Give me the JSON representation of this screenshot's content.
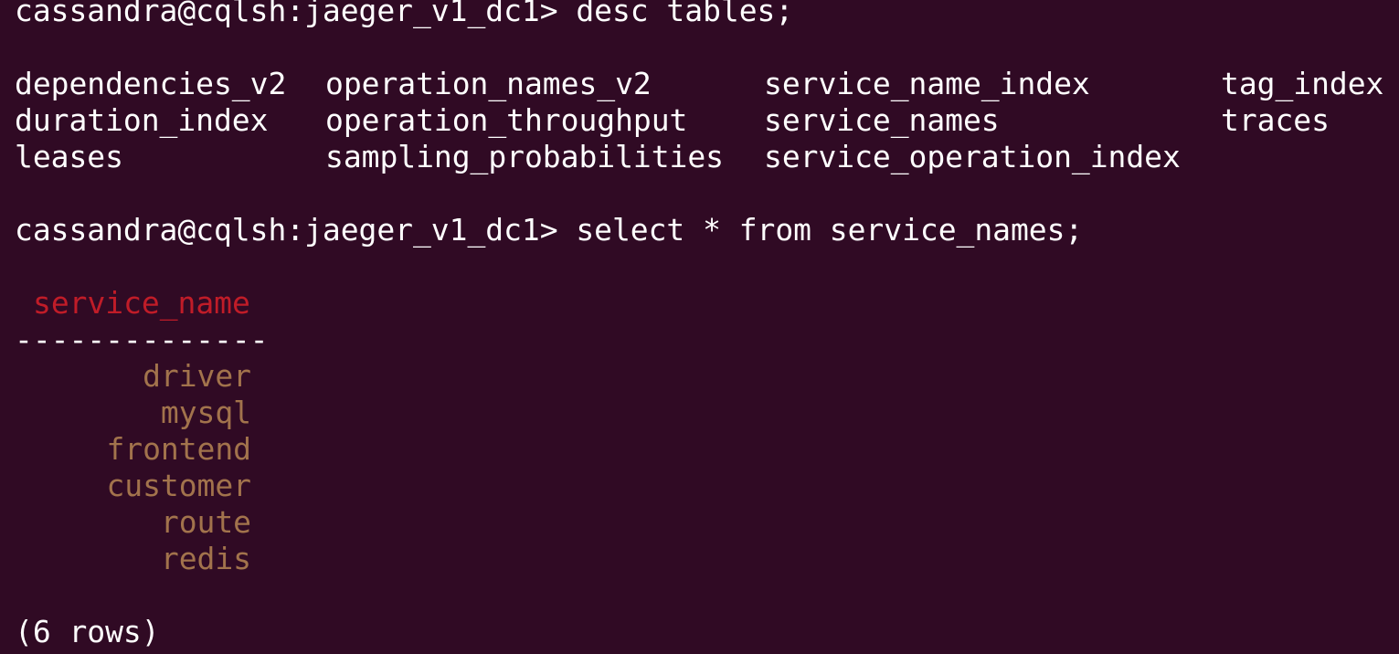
{
  "terminal": {
    "background_color": "#300a24",
    "text_color": "#ffffff",
    "header_color": "#c01c28",
    "value_color": "#a2734c",
    "prompt1": "cassandra@cqlsh:jaeger_v1_dc1> desc tables;",
    "tables": [
      [
        "dependencies_v2",
        "operation_names_v2",
        "service_name_index",
        "tag_index"
      ],
      [
        "duration_index",
        "operation_throughput",
        "service_names",
        "traces"
      ],
      [
        "leases",
        "sampling_probabilities",
        "service_operation_index",
        ""
      ]
    ],
    "prompt2": "cassandra@cqlsh:jaeger_v1_dc1> select * from service_names;",
    "result": {
      "column_header": "service_name",
      "separator": "--------------",
      "rows": [
        "driver",
        "mysql",
        "frontend",
        "customer",
        "route",
        "redis"
      ],
      "row_count": "(6 rows)"
    }
  }
}
